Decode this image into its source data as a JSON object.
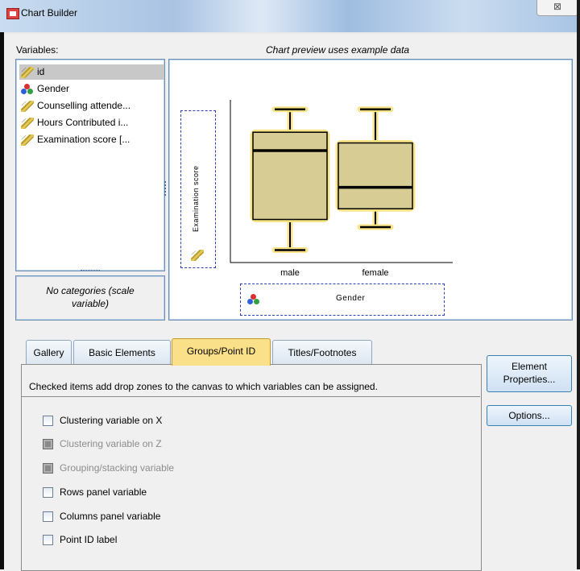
{
  "window": {
    "title": "Chart Builder",
    "close_symbol": "⊠"
  },
  "variables": {
    "label": "Variables:",
    "items": [
      {
        "name": "id",
        "icon": "scale-ruler-icon",
        "selected": true
      },
      {
        "name": "Gender",
        "icon": "nominal-balls-icon",
        "selected": false
      },
      {
        "name": "Counselling attende...",
        "icon": "scale-ruler-icon",
        "selected": false
      },
      {
        "name": "Hours Contributed i...",
        "icon": "scale-ruler-icon",
        "selected": false
      },
      {
        "name": "Examination score [...",
        "icon": "scale-ruler-icon",
        "selected": false
      }
    ],
    "categories_note": "No categories (scale variable)"
  },
  "preview": {
    "note": "Chart preview uses example data",
    "y_dropzone": "Examination score",
    "x_dropzone": "Gender",
    "categories": [
      "male",
      "female"
    ]
  },
  "chart_data": {
    "type": "boxplot",
    "categories": [
      "male",
      "female"
    ],
    "ylabel": "Examination score",
    "xlabel": "Gender",
    "boxes": [
      {
        "category": "male",
        "whisker_low": 0.05,
        "q1": 0.25,
        "median": 0.7,
        "q3": 0.82,
        "whisker_high": 0.97
      },
      {
        "category": "female",
        "whisker_low": 0.2,
        "q1": 0.32,
        "median": 0.46,
        "q3": 0.75,
        "whisker_high": 0.97
      }
    ]
  },
  "tabs": [
    {
      "label": "Gallery",
      "active": false
    },
    {
      "label": "Basic Elements",
      "active": false
    },
    {
      "label": "Groups/Point ID",
      "active": true
    },
    {
      "label": "Titles/Footnotes",
      "active": false
    }
  ],
  "groups_panel": {
    "description": "Checked items add drop zones to the canvas to which variables can be assigned.",
    "options": [
      {
        "label": "Clustering variable on X",
        "enabled": true,
        "checked": false
      },
      {
        "label": "Clustering variable on Z",
        "enabled": false,
        "checked": false
      },
      {
        "label": "Grouping/stacking variable",
        "enabled": false,
        "checked": false
      },
      {
        "label": "Rows panel variable",
        "enabled": true,
        "checked": false
      },
      {
        "label": "Columns panel variable",
        "enabled": true,
        "checked": false
      },
      {
        "label": "Point ID label",
        "enabled": true,
        "checked": false
      }
    ]
  },
  "buttons": {
    "element_properties_line1": "Element",
    "element_properties_line2": "Properties...",
    "options": "Options..."
  },
  "colors": {
    "box_fill": "#d7cd94",
    "box_glow": "#f8e487",
    "active_tab": "#fbe08a",
    "dropzone_border": "#2a3fb0"
  }
}
